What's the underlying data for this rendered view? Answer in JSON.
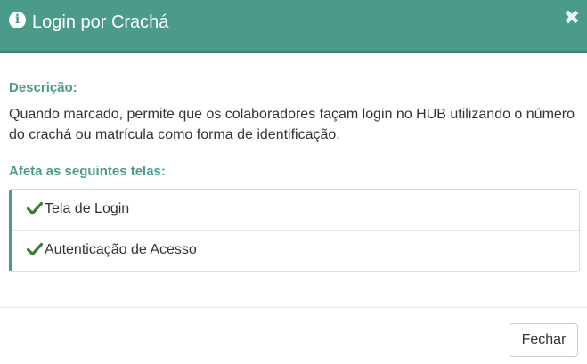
{
  "header": {
    "icon": "info-circle-icon",
    "title": "Login por Crachá",
    "close_symbol": "✖",
    "close_icon": "close-icon"
  },
  "description": {
    "label": "Descrição:",
    "text": "Quando marcado, permite que os colaboradores façam login no HUB utilizando o número do crachá ou matrícula como forma de identificação."
  },
  "affected_screens": {
    "label": "Afeta as seguintes telas:",
    "icon": "check-icon",
    "items": [
      {
        "label": "Tela de Login"
      },
      {
        "label": "Autenticação de Acesso"
      }
    ]
  },
  "footer": {
    "close_label": "Fechar"
  },
  "colors": {
    "accent": "#4a9b8a",
    "check": "#3c7a3c",
    "text": "#333333"
  }
}
